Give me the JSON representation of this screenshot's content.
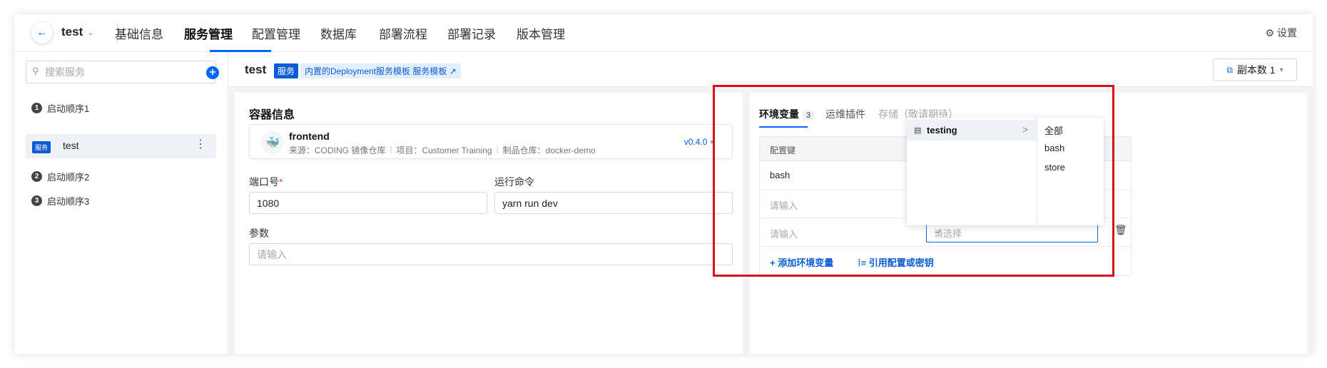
{
  "topnav": {
    "back_icon": "arrow-left-icon",
    "project": "test",
    "tabs": [
      "基础信息",
      "服务管理",
      "配置管理",
      "数据库",
      "部署流程",
      "部署记录",
      "版本管理"
    ],
    "active_tab": "服务管理",
    "settings_label": "设置",
    "accent": "#0066ff"
  },
  "sidebar": {
    "search_placeholder": "搜索服务",
    "steps": [
      {
        "num": "1",
        "label": "启动顺序1"
      },
      {
        "num": "2",
        "label": "启动顺序2"
      },
      {
        "num": "3",
        "label": "启动顺序3"
      }
    ],
    "service": {
      "badge": "服务",
      "name": "test",
      "more": "⋮"
    }
  },
  "header": {
    "title": "test",
    "badge": "服务",
    "template_link": "内置的Deployment服务模板 服务模板 ↗",
    "replica_label": "副本数 1"
  },
  "container": {
    "section_title": "容器信息",
    "name": "frontend",
    "meta": [
      "来源：CODING 镜像仓库",
      "项目：Customer Training",
      "制品仓库：docker-demo"
    ],
    "version": "v0.4.0"
  },
  "form": {
    "port_label": "端口号",
    "port_required": "*",
    "port_value": "1080",
    "cmd_label": "运行命令",
    "cmd_value": "yarn run dev",
    "args_label": "参数",
    "args_placeholder": "请输入"
  },
  "env": {
    "tabs": [
      {
        "label": "环境变量",
        "count": "3"
      },
      {
        "label": "运维插件"
      },
      {
        "label": "存储（敬请期待）"
      }
    ],
    "column_key": "配置键",
    "rows": [
      {
        "key": "bash"
      },
      {
        "key": "请输入"
      },
      {
        "key": "请输入"
      }
    ],
    "select_placeholder": "请选择",
    "add_label": "添加环境变量",
    "ref_label": "引用配置或密钥"
  },
  "popup": {
    "primary": "testing",
    "secondary": [
      "全部",
      "bash",
      "store"
    ]
  },
  "highlight_color": "#d6101c"
}
